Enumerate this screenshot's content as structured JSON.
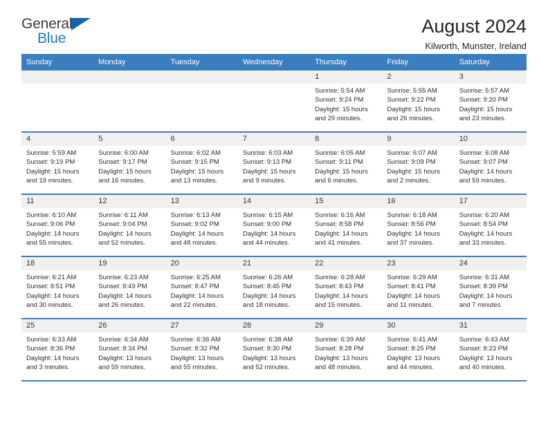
{
  "brand": {
    "name_part1": "General",
    "name_part2": "Blue",
    "triangle_color": "#1565ad",
    "blue": "#1f7ac4"
  },
  "header": {
    "title": "August 2024",
    "subtitle": "Kilworth, Munster, Ireland",
    "accent_color": "#3a7ebf",
    "daynum_band_color": "#f0f0f0"
  },
  "weekdays": [
    "Sunday",
    "Monday",
    "Tuesday",
    "Wednesday",
    "Thursday",
    "Friday",
    "Saturday"
  ],
  "weeks": [
    [
      {
        "day": "",
        "empty": true,
        "sunrise": "",
        "sunset": "",
        "daylight1": "",
        "daylight2": ""
      },
      {
        "day": "",
        "empty": true,
        "sunrise": "",
        "sunset": "",
        "daylight1": "",
        "daylight2": ""
      },
      {
        "day": "",
        "empty": true,
        "sunrise": "",
        "sunset": "",
        "daylight1": "",
        "daylight2": ""
      },
      {
        "day": "",
        "empty": true,
        "sunrise": "",
        "sunset": "",
        "daylight1": "",
        "daylight2": ""
      },
      {
        "day": "1",
        "sunrise": "Sunrise: 5:54 AM",
        "sunset": "Sunset: 9:24 PM",
        "daylight1": "Daylight: 15 hours",
        "daylight2": "and 29 minutes."
      },
      {
        "day": "2",
        "sunrise": "Sunrise: 5:55 AM",
        "sunset": "Sunset: 9:22 PM",
        "daylight1": "Daylight: 15 hours",
        "daylight2": "and 26 minutes."
      },
      {
        "day": "3",
        "sunrise": "Sunrise: 5:57 AM",
        "sunset": "Sunset: 9:20 PM",
        "daylight1": "Daylight: 15 hours",
        "daylight2": "and 23 minutes."
      }
    ],
    [
      {
        "day": "4",
        "sunrise": "Sunrise: 5:59 AM",
        "sunset": "Sunset: 9:19 PM",
        "daylight1": "Daylight: 15 hours",
        "daylight2": "and 19 minutes."
      },
      {
        "day": "5",
        "sunrise": "Sunrise: 6:00 AM",
        "sunset": "Sunset: 9:17 PM",
        "daylight1": "Daylight: 15 hours",
        "daylight2": "and 16 minutes."
      },
      {
        "day": "6",
        "sunrise": "Sunrise: 6:02 AM",
        "sunset": "Sunset: 9:15 PM",
        "daylight1": "Daylight: 15 hours",
        "daylight2": "and 13 minutes."
      },
      {
        "day": "7",
        "sunrise": "Sunrise: 6:03 AM",
        "sunset": "Sunset: 9:13 PM",
        "daylight1": "Daylight: 15 hours",
        "daylight2": "and 9 minutes."
      },
      {
        "day": "8",
        "sunrise": "Sunrise: 6:05 AM",
        "sunset": "Sunset: 9:11 PM",
        "daylight1": "Daylight: 15 hours",
        "daylight2": "and 6 minutes."
      },
      {
        "day": "9",
        "sunrise": "Sunrise: 6:07 AM",
        "sunset": "Sunset: 9:09 PM",
        "daylight1": "Daylight: 15 hours",
        "daylight2": "and 2 minutes."
      },
      {
        "day": "10",
        "sunrise": "Sunrise: 6:08 AM",
        "sunset": "Sunset: 9:07 PM",
        "daylight1": "Daylight: 14 hours",
        "daylight2": "and 59 minutes."
      }
    ],
    [
      {
        "day": "11",
        "sunrise": "Sunrise: 6:10 AM",
        "sunset": "Sunset: 9:06 PM",
        "daylight1": "Daylight: 14 hours",
        "daylight2": "and 55 minutes."
      },
      {
        "day": "12",
        "sunrise": "Sunrise: 6:11 AM",
        "sunset": "Sunset: 9:04 PM",
        "daylight1": "Daylight: 14 hours",
        "daylight2": "and 52 minutes."
      },
      {
        "day": "13",
        "sunrise": "Sunrise: 6:13 AM",
        "sunset": "Sunset: 9:02 PM",
        "daylight1": "Daylight: 14 hours",
        "daylight2": "and 48 minutes."
      },
      {
        "day": "14",
        "sunrise": "Sunrise: 6:15 AM",
        "sunset": "Sunset: 9:00 PM",
        "daylight1": "Daylight: 14 hours",
        "daylight2": "and 44 minutes."
      },
      {
        "day": "15",
        "sunrise": "Sunrise: 6:16 AM",
        "sunset": "Sunset: 8:58 PM",
        "daylight1": "Daylight: 14 hours",
        "daylight2": "and 41 minutes."
      },
      {
        "day": "16",
        "sunrise": "Sunrise: 6:18 AM",
        "sunset": "Sunset: 8:56 PM",
        "daylight1": "Daylight: 14 hours",
        "daylight2": "and 37 minutes."
      },
      {
        "day": "17",
        "sunrise": "Sunrise: 6:20 AM",
        "sunset": "Sunset: 8:54 PM",
        "daylight1": "Daylight: 14 hours",
        "daylight2": "and 33 minutes."
      }
    ],
    [
      {
        "day": "18",
        "sunrise": "Sunrise: 6:21 AM",
        "sunset": "Sunset: 8:51 PM",
        "daylight1": "Daylight: 14 hours",
        "daylight2": "and 30 minutes."
      },
      {
        "day": "19",
        "sunrise": "Sunrise: 6:23 AM",
        "sunset": "Sunset: 8:49 PM",
        "daylight1": "Daylight: 14 hours",
        "daylight2": "and 26 minutes."
      },
      {
        "day": "20",
        "sunrise": "Sunrise: 6:25 AM",
        "sunset": "Sunset: 8:47 PM",
        "daylight1": "Daylight: 14 hours",
        "daylight2": "and 22 minutes."
      },
      {
        "day": "21",
        "sunrise": "Sunrise: 6:26 AM",
        "sunset": "Sunset: 8:45 PM",
        "daylight1": "Daylight: 14 hours",
        "daylight2": "and 18 minutes."
      },
      {
        "day": "22",
        "sunrise": "Sunrise: 6:28 AM",
        "sunset": "Sunset: 8:43 PM",
        "daylight1": "Daylight: 14 hours",
        "daylight2": "and 15 minutes."
      },
      {
        "day": "23",
        "sunrise": "Sunrise: 6:29 AM",
        "sunset": "Sunset: 8:41 PM",
        "daylight1": "Daylight: 14 hours",
        "daylight2": "and 11 minutes."
      },
      {
        "day": "24",
        "sunrise": "Sunrise: 6:31 AM",
        "sunset": "Sunset: 8:39 PM",
        "daylight1": "Daylight: 14 hours",
        "daylight2": "and 7 minutes."
      }
    ],
    [
      {
        "day": "25",
        "sunrise": "Sunrise: 6:33 AM",
        "sunset": "Sunset: 8:36 PM",
        "daylight1": "Daylight: 14 hours",
        "daylight2": "and 3 minutes."
      },
      {
        "day": "26",
        "sunrise": "Sunrise: 6:34 AM",
        "sunset": "Sunset: 8:34 PM",
        "daylight1": "Daylight: 13 hours",
        "daylight2": "and 59 minutes."
      },
      {
        "day": "27",
        "sunrise": "Sunrise: 6:36 AM",
        "sunset": "Sunset: 8:32 PM",
        "daylight1": "Daylight: 13 hours",
        "daylight2": "and 55 minutes."
      },
      {
        "day": "28",
        "sunrise": "Sunrise: 6:38 AM",
        "sunset": "Sunset: 8:30 PM",
        "daylight1": "Daylight: 13 hours",
        "daylight2": "and 52 minutes."
      },
      {
        "day": "29",
        "sunrise": "Sunrise: 6:39 AM",
        "sunset": "Sunset: 8:28 PM",
        "daylight1": "Daylight: 13 hours",
        "daylight2": "and 48 minutes."
      },
      {
        "day": "30",
        "sunrise": "Sunrise: 6:41 AM",
        "sunset": "Sunset: 8:25 PM",
        "daylight1": "Daylight: 13 hours",
        "daylight2": "and 44 minutes."
      },
      {
        "day": "31",
        "sunrise": "Sunrise: 6:43 AM",
        "sunset": "Sunset: 8:23 PM",
        "daylight1": "Daylight: 13 hours",
        "daylight2": "and 40 minutes."
      }
    ]
  ]
}
